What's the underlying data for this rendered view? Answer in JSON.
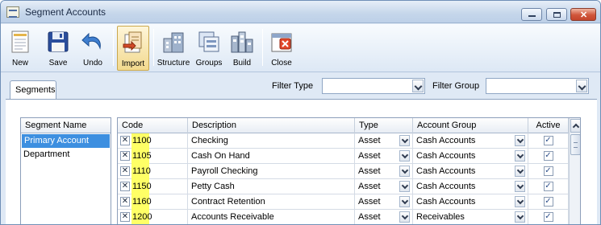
{
  "window": {
    "title": "Segment Accounts"
  },
  "toolbar": {
    "buttons": [
      {
        "id": "new",
        "label": "New",
        "icon": "new-document-icon"
      },
      {
        "id": "save",
        "label": "Save",
        "icon": "floppy-disk-icon"
      },
      {
        "id": "undo",
        "label": "Undo",
        "icon": "undo-arrow-icon"
      },
      {
        "id": "import",
        "label": "Import",
        "icon": "import-icon",
        "pressed": true
      },
      {
        "id": "structure",
        "label": "Structure",
        "icon": "buildings-icon"
      },
      {
        "id": "groups",
        "label": "Groups",
        "icon": "groups-icon"
      },
      {
        "id": "build",
        "label": "Build",
        "icon": "build-icon"
      },
      {
        "id": "close",
        "label": "Close",
        "icon": "close-window-icon"
      }
    ]
  },
  "tabs": {
    "segments": "Segments"
  },
  "filters": {
    "type_label": "Filter Type",
    "type_value": "",
    "group_label": "Filter Group",
    "group_value": ""
  },
  "segment_list": {
    "header": "Segment Name",
    "items": [
      "Primary Account",
      "Department"
    ],
    "selected": 0
  },
  "grid": {
    "columns": [
      "Code",
      "Description",
      "Type",
      "Account Group",
      "Active"
    ],
    "rows": [
      {
        "code": "1100",
        "description": "Checking",
        "type": "Asset",
        "group": "Cash Accounts",
        "active": true
      },
      {
        "code": "1105",
        "description": "Cash On Hand",
        "type": "Asset",
        "group": "Cash Accounts",
        "active": true
      },
      {
        "code": "1110",
        "description": "Payroll Checking",
        "type": "Asset",
        "group": "Cash Accounts",
        "active": true
      },
      {
        "code": "1150",
        "description": "Petty Cash",
        "type": "Asset",
        "group": "Cash Accounts",
        "active": true
      },
      {
        "code": "1160",
        "description": "Contract Retention",
        "type": "Asset",
        "group": "Cash Accounts",
        "active": true
      },
      {
        "code": "1200",
        "description": "Accounts Receivable",
        "type": "Asset",
        "group": "Receivables",
        "active": true
      }
    ]
  },
  "colors": {
    "highlight_code": "#ffff66",
    "selection": "#3d8fe0",
    "accent": "#6f8fb7"
  }
}
